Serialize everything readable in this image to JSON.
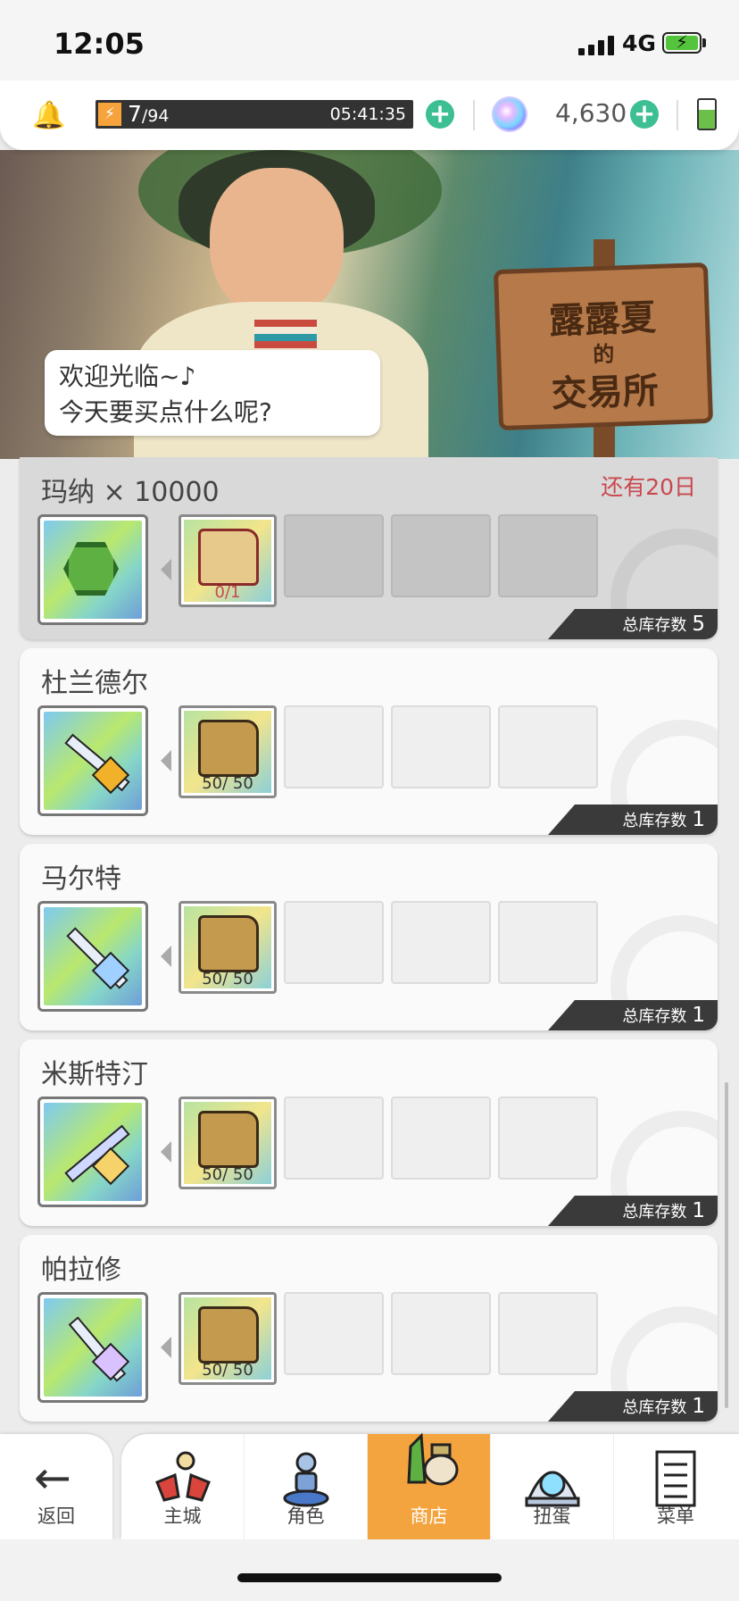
{
  "status": {
    "time": "12:05",
    "network": "4G"
  },
  "resources": {
    "stamina_current": "7",
    "stamina_max": "/94",
    "stamina_timer": "05:41:35",
    "gems": "4,630"
  },
  "banner": {
    "sign_line1": "露露夏",
    "sign_line2": "的",
    "sign_line3": "交易所",
    "greeting_line1": "欢迎光临~♪",
    "greeting_line2": "今天要买点什么呢?"
  },
  "stock_label": "总库存数",
  "items": [
    {
      "name": "玛纳 × 10000",
      "remaining": "还有20日",
      "material_count": "0/1",
      "stock": "5",
      "icon": "green-gem-icon"
    },
    {
      "name": "杜兰德尔",
      "remaining": "",
      "material_count": "50/ 50",
      "stock": "1",
      "icon": "sword-icon"
    },
    {
      "name": "马尔特",
      "remaining": "",
      "material_count": "50/ 50",
      "stock": "1",
      "icon": "spear-icon"
    },
    {
      "name": "米斯特汀",
      "remaining": "",
      "material_count": "50/ 50",
      "stock": "1",
      "icon": "bow-icon"
    },
    {
      "name": "帕拉修",
      "remaining": "",
      "material_count": "50/ 50",
      "stock": "1",
      "icon": "axe-icon"
    }
  ],
  "nav": {
    "back": "返回",
    "tabs": [
      {
        "label": "主城",
        "icon": "castle-icon"
      },
      {
        "label": "角色",
        "icon": "character-icon"
      },
      {
        "label": "商店",
        "icon": "shop-icon"
      },
      {
        "label": "扭蛋",
        "icon": "gacha-icon"
      },
      {
        "label": "菜单",
        "icon": "menu-icon"
      }
    ],
    "active_tab": "商店"
  },
  "colors": {
    "accent": "#f4a43e",
    "plus": "#3cbf92",
    "remaining": "#c9484e"
  }
}
